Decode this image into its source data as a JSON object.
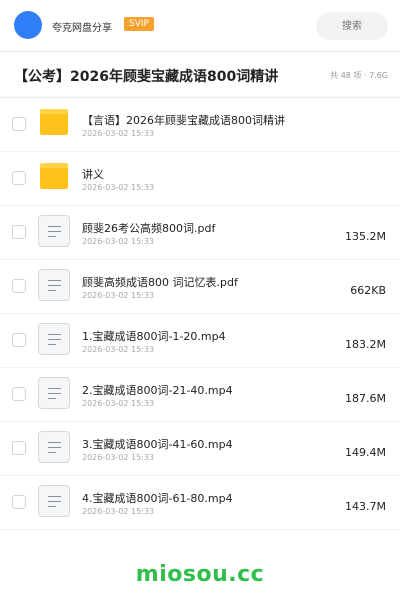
{
  "header": {
    "username": "夸克网盘分享",
    "badge": "SVIP",
    "search_placeholder": "搜索"
  },
  "folder": {
    "title": "【公考】2026年顾斐宝藏成语800词精讲",
    "meta": "共 48 项 · 7.6G"
  },
  "files": [
    {
      "type": "folder",
      "name": "【言语】2026年顾斐宝藏成语800词精讲",
      "date": "2026-03-02 15:33",
      "size": ""
    },
    {
      "type": "folder",
      "name": "讲义",
      "date": "2026-03-02 15:33",
      "size": ""
    },
    {
      "type": "file",
      "name": "顾斐26考公高频800词.pdf",
      "date": "2026-03-02 15:33",
      "size": "135.2M"
    },
    {
      "type": "file",
      "name": "顾斐高频成语800 词记忆表.pdf",
      "date": "2026-03-02 15:33",
      "size": "662KB"
    },
    {
      "type": "file",
      "name": "1.宝藏成语800词-1-20.mp4",
      "date": "2026-03-02 15:33",
      "size": "183.2M"
    },
    {
      "type": "file",
      "name": "2.宝藏成语800词-21-40.mp4",
      "date": "2026-03-02 15:33",
      "size": "187.6M"
    },
    {
      "type": "file",
      "name": "3.宝藏成语800词-41-60.mp4",
      "date": "2026-03-02 15:33",
      "size": "149.4M"
    },
    {
      "type": "file",
      "name": "4.宝藏成语800词-61-80.mp4",
      "date": "2026-03-02 15:33",
      "size": "143.7M"
    }
  ],
  "watermark": "miosou.cc",
  "colors": {
    "avatar": "#2f7ef5",
    "svip": "#f7a12f",
    "folder": "#ffc21c",
    "watermark": "#2fbf4a"
  }
}
